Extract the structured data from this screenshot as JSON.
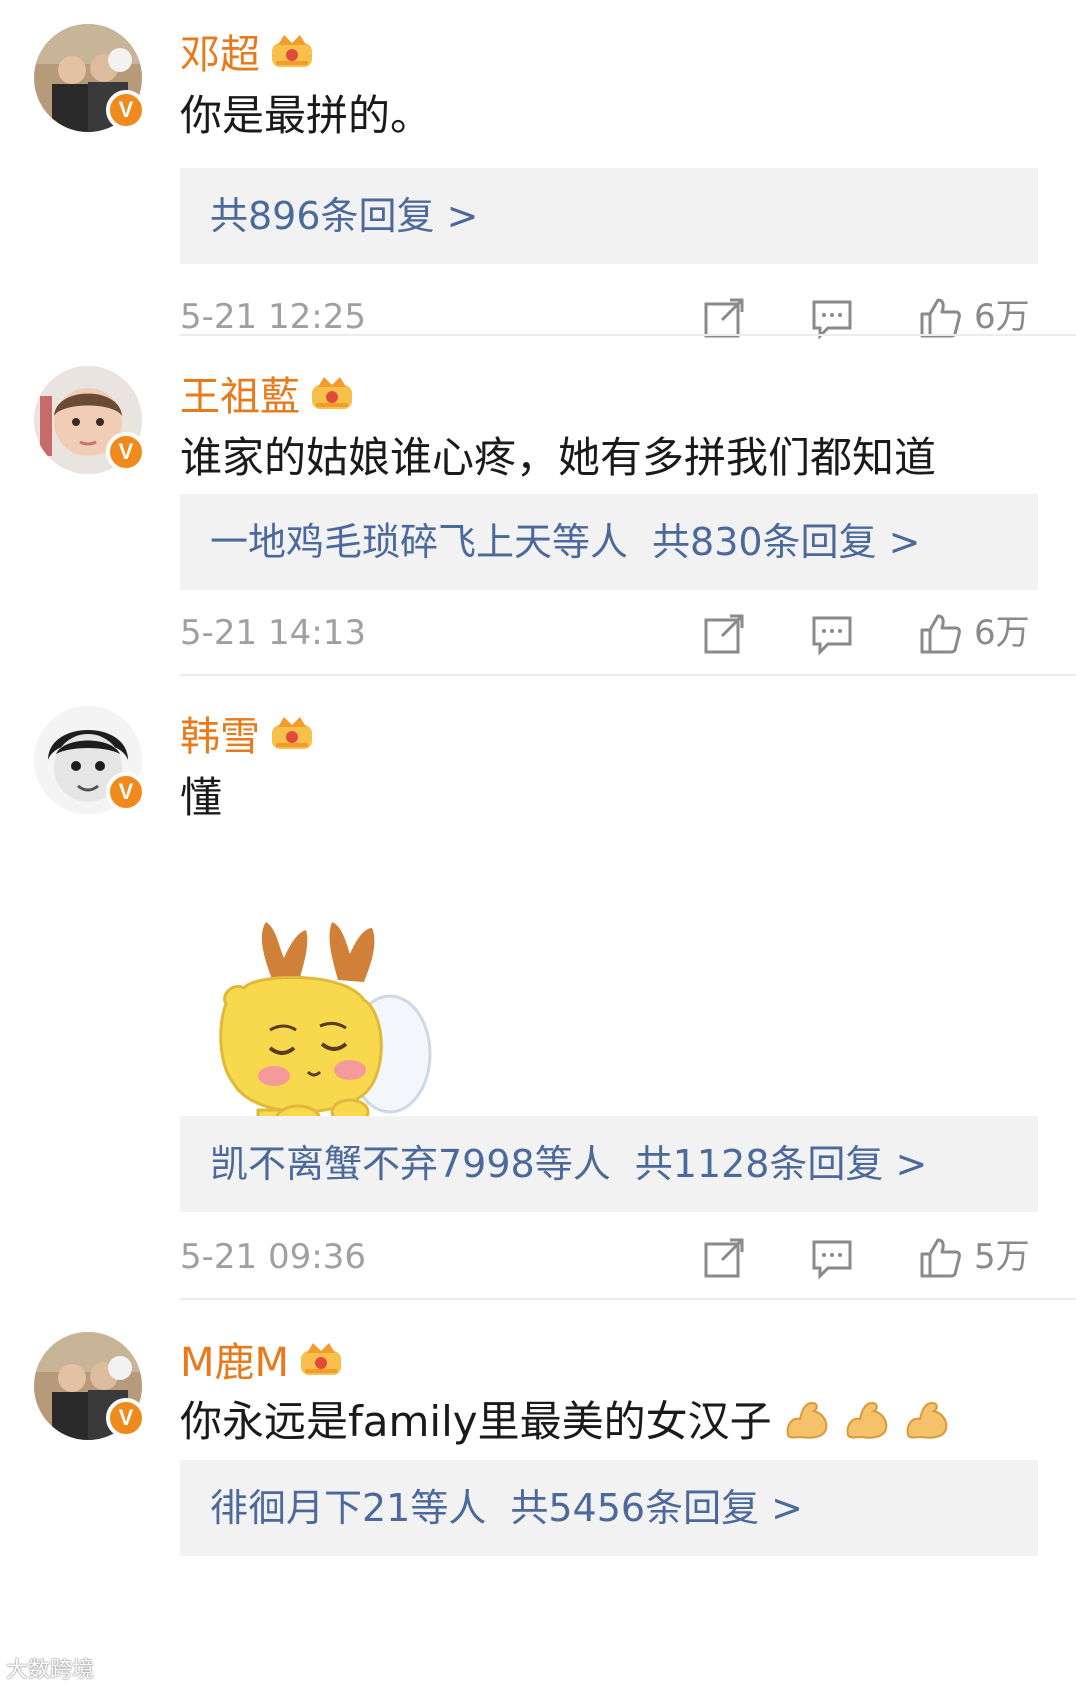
{
  "comments": [
    {
      "username": "邓超",
      "text": "你是最拼的。",
      "reply": {
        "users": "",
        "count_label": "共896条回复 >"
      },
      "timestamp": "5-21 12:25",
      "likes": "6万"
    },
    {
      "username": "王祖藍",
      "text": "谁家的姑娘谁心疼，她有多拼我们都知道",
      "reply": {
        "users": "一地鸡毛琐碎飞上天等人",
        "count_label": "共830条回复 >"
      },
      "timestamp": "5-21 14:13",
      "likes": "6万"
    },
    {
      "username": "韩雪",
      "text": "懂",
      "reply": {
        "users": "凯不离蟹不弃7998等人",
        "count_label": "共1128条回复 >"
      },
      "timestamp": "5-21 09:36",
      "likes": "5万"
    },
    {
      "username": "M鹿M",
      "text": "你永远是family里最美的女汉子",
      "reply": {
        "users": "徘徊月下21等人",
        "count_label": "共5456条回复 >"
      },
      "timestamp": "",
      "likes": ""
    }
  ],
  "badge_label": "V",
  "watermark": "大数跨境",
  "colors": {
    "username": "#e87a1b",
    "reply_link": "#4b6a9b",
    "badge": "#f08a1d",
    "meta": "#a0a0a0"
  },
  "icons": [
    "crown-icon",
    "repost-icon",
    "comment-icon",
    "like-icon",
    "flexed-biceps-emoji",
    "verified-badge"
  ]
}
